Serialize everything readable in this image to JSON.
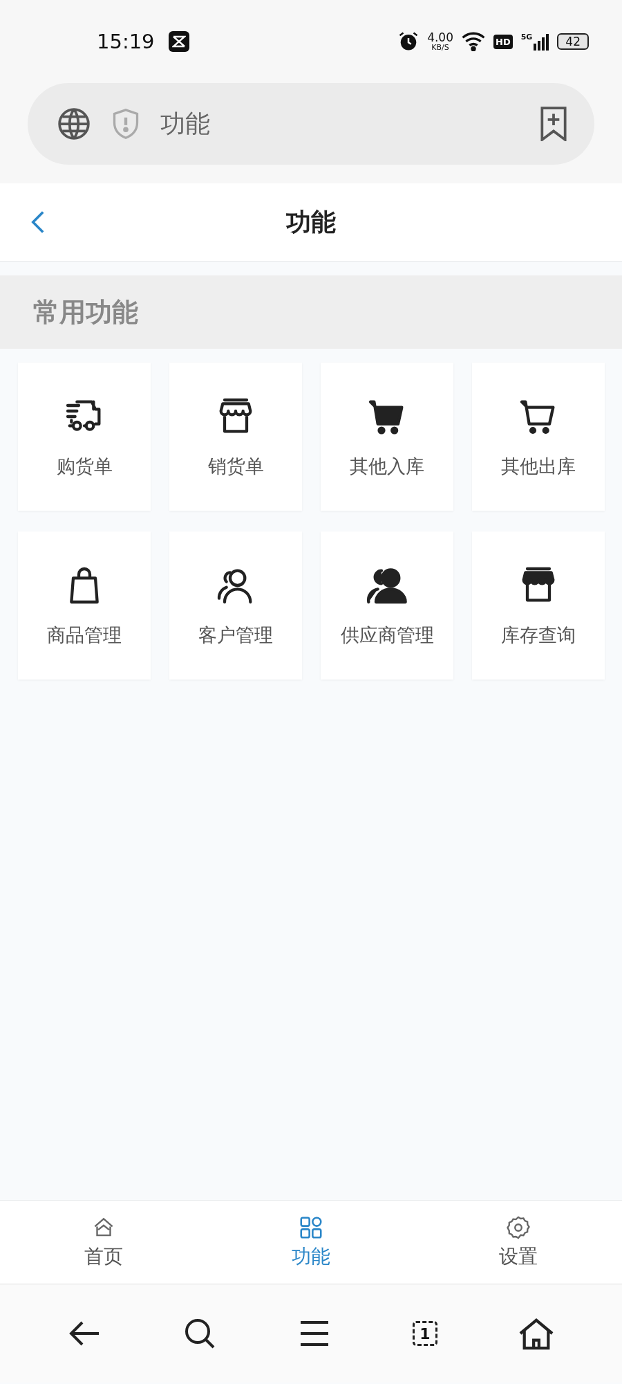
{
  "status_bar": {
    "time": "15:19",
    "speed": "4.00",
    "speed_unit": "KB/S",
    "hd": "HD",
    "network": "5G",
    "battery": "42"
  },
  "address_bar": {
    "title": "功能"
  },
  "header": {
    "title": "功能"
  },
  "section": {
    "title": "常用功能"
  },
  "functions": [
    {
      "label": "购货单"
    },
    {
      "label": "销货单"
    },
    {
      "label": "其他入库"
    },
    {
      "label": "其他出库"
    },
    {
      "label": "商品管理"
    },
    {
      "label": "客户管理"
    },
    {
      "label": "供应商管理"
    },
    {
      "label": "库存查询"
    }
  ],
  "tab_bar": [
    {
      "label": "首页",
      "selected": false
    },
    {
      "label": "功能",
      "selected": true
    },
    {
      "label": "设置",
      "selected": false
    }
  ],
  "browser_nav": {
    "tab_count": "1"
  }
}
